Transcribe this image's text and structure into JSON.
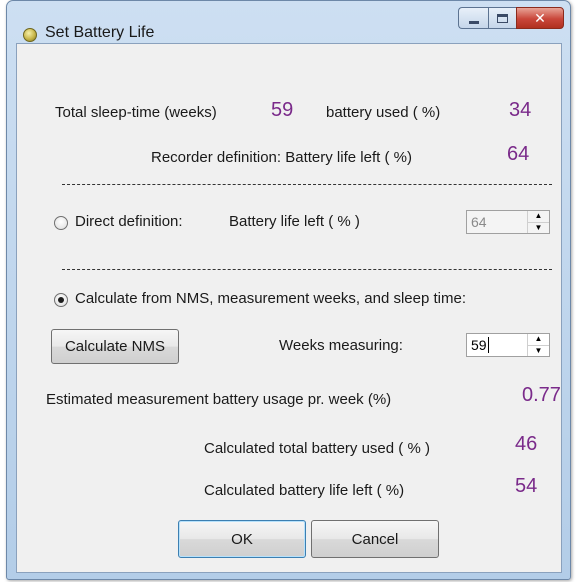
{
  "window": {
    "title": "Set Battery Life"
  },
  "summary": {
    "total_sleep_label": "Total sleep-time (weeks)",
    "total_sleep_value": "59",
    "battery_used_label": "battery used ( %)",
    "battery_used_value": "34",
    "recorder_label": "Recorder definition: Battery life left ( %)",
    "recorder_value": "64"
  },
  "direct": {
    "radio_label": "Direct definition:",
    "field_label": "Battery life left ( % )",
    "field_value": "64",
    "checked": false
  },
  "calculate": {
    "radio_label": "Calculate from NMS, measurement weeks, and sleep time:",
    "checked": true,
    "nms_button": "Calculate NMS",
    "weeks_label": "Weeks measuring:",
    "weeks_value": "59",
    "usage_label": "Estimated measurement battery usage pr. week (%)",
    "usage_value": "0.77",
    "total_used_label": "Calculated total battery used ( % )",
    "total_used_value": "46",
    "life_left_label": "Calculated battery life left  ( %)",
    "life_left_value": "54"
  },
  "buttons": {
    "ok": "OK",
    "cancel": "Cancel"
  },
  "icons": {
    "app": "battery-app-icon",
    "minimize": "minimize-icon",
    "maximize": "maximize-icon",
    "close": "close-icon",
    "spin_up": "chevron-up-icon",
    "spin_down": "chevron-down-icon"
  },
  "colors": {
    "value_text": "#7a2a8a",
    "close_button": "#c9463a",
    "title_bar": "#cddff2"
  }
}
